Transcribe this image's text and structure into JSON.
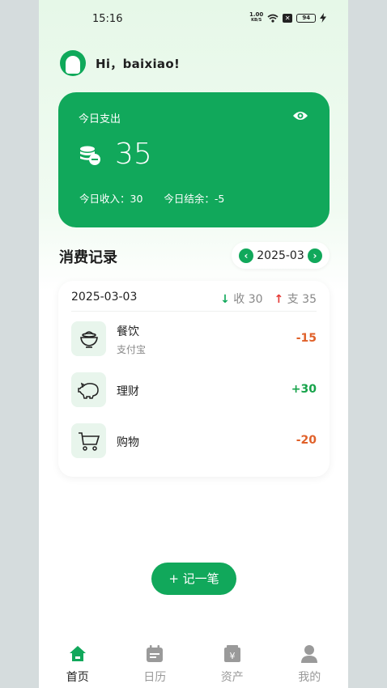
{
  "status_bar": {
    "time": "15:16",
    "net_speed_value": "1.00",
    "net_speed_unit": "KB/S",
    "notification_icon": "x-icon",
    "battery_level": "94"
  },
  "greeting": {
    "text": "Hi，baixiao!"
  },
  "expense_card": {
    "title": "今日支出",
    "amount": "35",
    "income_label": "今日收入：30",
    "balance_label": "今日结余：-5",
    "color": "#11a85b"
  },
  "records": {
    "section_title": "消费记录",
    "month": "2025-03",
    "date": "2025-03-03",
    "income_summary": "收 30",
    "expense_summary": "支 35",
    "items": [
      {
        "name": "餐饮",
        "sub": "支付宝",
        "amount": "-15",
        "icon": "rice-bowl-icon"
      },
      {
        "name": "理财",
        "sub": "",
        "amount": "+30",
        "icon": "piggy-bank-icon"
      },
      {
        "name": "购物",
        "sub": "",
        "amount": "-20",
        "icon": "shopping-cart-icon"
      }
    ]
  },
  "add_button": {
    "label": "+ 记一笔"
  },
  "tabs": [
    {
      "label": "首页",
      "icon": "home-icon",
      "active": true
    },
    {
      "label": "日历",
      "icon": "calendar-icon",
      "active": false
    },
    {
      "label": "资产",
      "icon": "wallet-icon",
      "active": false
    },
    {
      "label": "我的",
      "icon": "user-icon",
      "active": false
    }
  ],
  "colors": {
    "accent": "#11a85b",
    "negative": "#e0612a",
    "positive": "#16a34a",
    "up_arrow": "#e53935"
  }
}
